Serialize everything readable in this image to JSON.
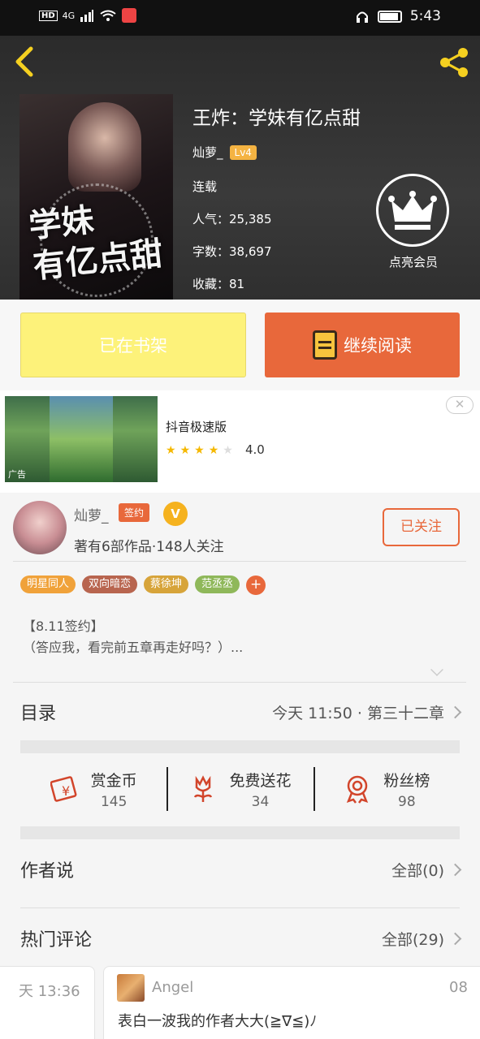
{
  "status_bar": {
    "network": "4G",
    "time": "5:43"
  },
  "book": {
    "title": "王炸：学妹有亿点甜",
    "cover_title_art": "学妹\n有亿点甜",
    "author": "灿萝_",
    "level": "Lv4",
    "status": "连载",
    "popularity": "人气：25,385",
    "word_count": "字数：38,697",
    "favorites": "收藏：81",
    "member_label": "点亮会员"
  },
  "buttons": {
    "shelf": "已在书架",
    "read": "继续阅读"
  },
  "ad": {
    "tag": "广告",
    "name": "抖音极速版",
    "stars": 4,
    "rating": "4.0",
    "close": "✕"
  },
  "author_card": {
    "name": "灿萝_",
    "sign_badge": "签约",
    "v_badge": "V",
    "stats": "著有6部作品·148人关注",
    "follow": "已关注"
  },
  "tags": [
    {
      "label": "明星同人",
      "color": "#f0a23a"
    },
    {
      "label": "双向暗恋",
      "color": "#b8654f"
    },
    {
      "label": "蔡徐坤",
      "color": "#d7a43a"
    },
    {
      "label": "范丞丞",
      "color": "#8fb85a"
    }
  ],
  "tag_more": "+",
  "intro": {
    "line1": "【8.11签约】",
    "line2": "（答应我，看完前五章再走好吗？）..."
  },
  "catalog": {
    "title": "目录",
    "latest": "今天 11:50 · 第三十二章"
  },
  "actions": [
    {
      "label": "赏金币",
      "value": "145",
      "icon": "coin-envelope-icon"
    },
    {
      "label": "免费送花",
      "value": "34",
      "icon": "flower-icon"
    },
    {
      "label": "粉丝榜",
      "value": "98",
      "icon": "medal-icon"
    }
  ],
  "author_says": {
    "title": "作者说",
    "all": "全部(0)"
  },
  "hot_comments": {
    "title": "热门评论",
    "all": "全部(29)",
    "prev_time": "天 13:36",
    "user": "Angel",
    "text": "表白一波我的作者大大(≧∇≦)ﾉ",
    "next_time": "08"
  },
  "colors": {
    "accent": "#e8683b",
    "shelf_yellow": "#fdf27a",
    "gold": "#f5b21f"
  }
}
